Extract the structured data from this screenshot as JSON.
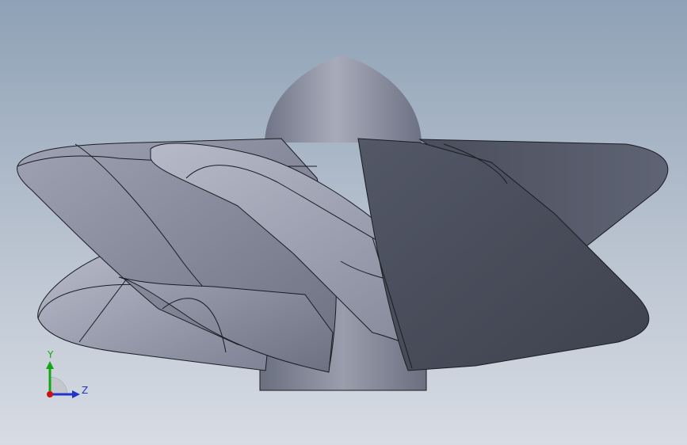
{
  "viewport": {
    "background_top": "#8ea1b6",
    "background_bottom": "#d7dce4",
    "model": {
      "shaded_color": "#7b8092",
      "edge_color": "#1a1c22"
    },
    "triad": {
      "y_label": "Y",
      "z_label": "Z",
      "y_color": "#14a514",
      "z_color": "#2233cc",
      "x_color": "#cc1111"
    }
  }
}
